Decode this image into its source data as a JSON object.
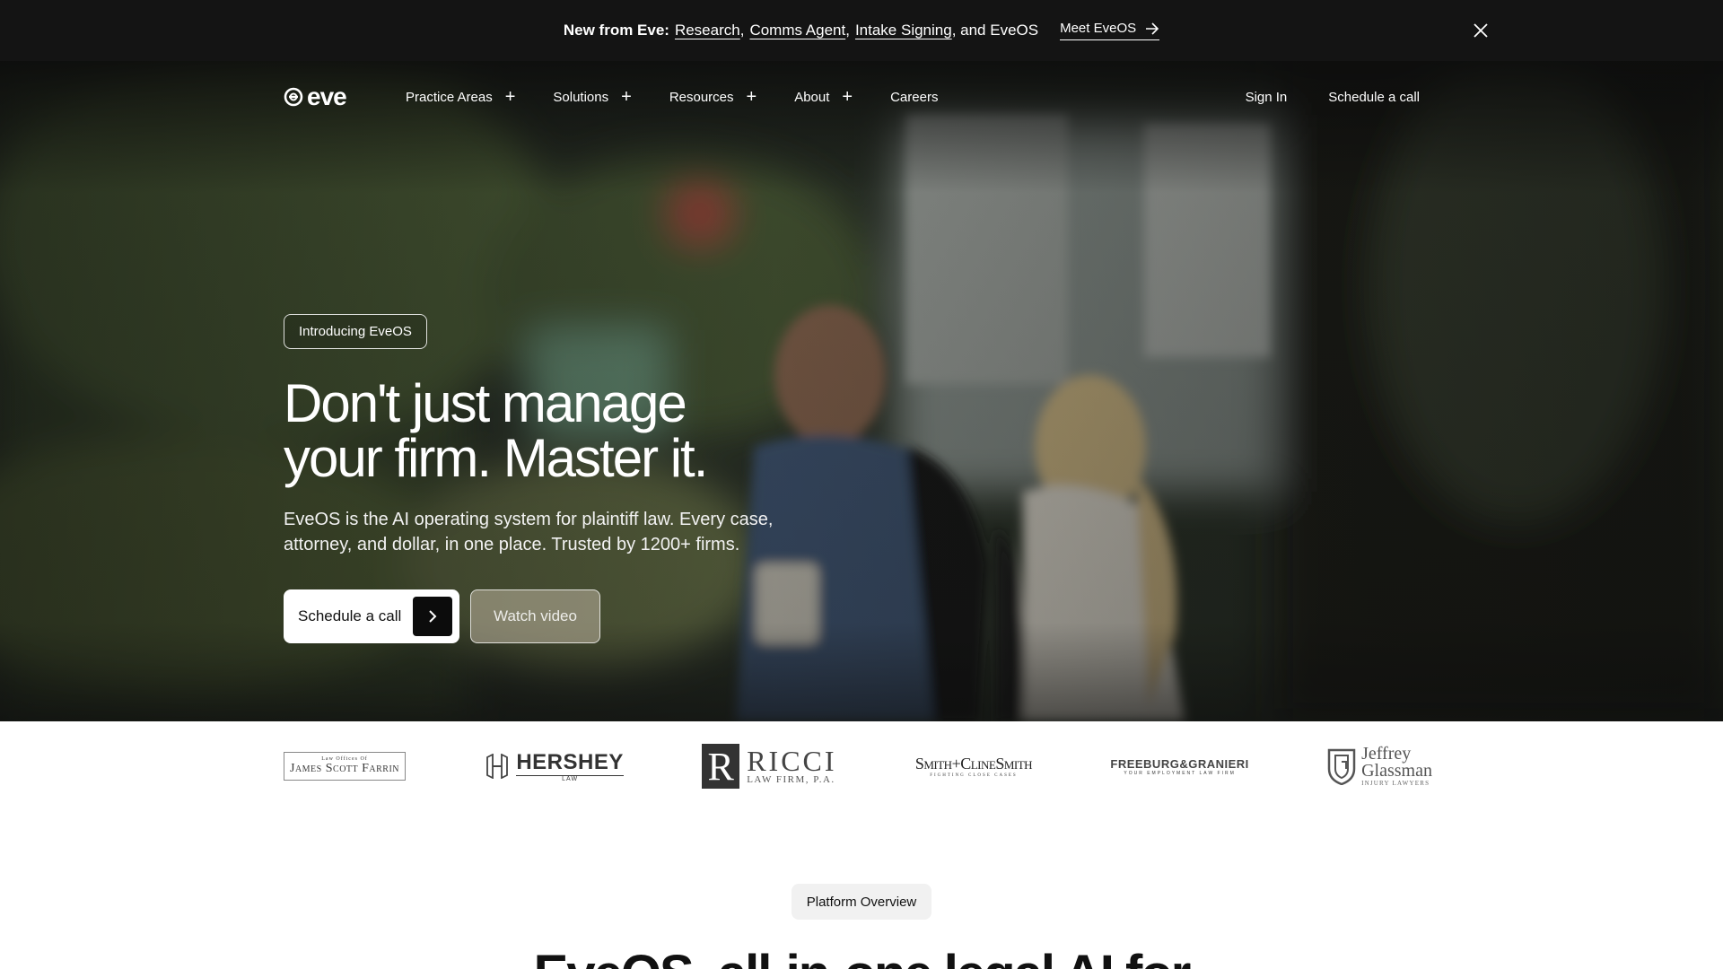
{
  "announcement": {
    "prefix": "New from Eve:",
    "links": [
      "Research",
      "Comms Agent",
      "Intake Signing"
    ],
    "separator": ",",
    "suffix": ", and EveOS",
    "cta_label": "Meet EveOS",
    "close_icon": "close-icon"
  },
  "nav": {
    "brand": "eve",
    "items": [
      {
        "label": "Practice Areas",
        "expandable": true
      },
      {
        "label": "Solutions",
        "expandable": true
      },
      {
        "label": "Resources",
        "expandable": true
      },
      {
        "label": "About",
        "expandable": true
      },
      {
        "label": "Careers",
        "expandable": false
      }
    ],
    "plus_symbol": "+",
    "sign_in": "Sign In",
    "schedule": "Schedule a call"
  },
  "hero": {
    "badge": "Introducing EveOS",
    "headline_line1": "Don't just manage",
    "headline_line2": "your firm. Master it.",
    "subtext": "EveOS is the AI operating system for plaintiff law. Every case, attorney, and dollar, in one place. Trusted by 1200+ firms.",
    "primary_cta": "Schedule a call",
    "secondary_cta": "Watch video"
  },
  "logos": {
    "farrin_small": "Law Offices Of",
    "farrin_name": "James Scott Farrin",
    "hershey_name": "HERSHEY",
    "hershey_sub": "LAW",
    "ricci_letter": "R",
    "ricci_name": "RICCI",
    "ricci_sub": "LAW FIRM, P.A.",
    "smith_name": "Smith+ClineSmith",
    "smith_sub": "FIGHTING CLOSE CASES",
    "freeburg_name": "FREEBURG&GRANIERI",
    "freeburg_sub": "YOUR EMPLOYMENT LAW FIRM",
    "glassman_line1": "Jeffrey",
    "glassman_line2": "Glassman",
    "glassman_sub": "INJURY LAWYERS"
  },
  "overview": {
    "badge": "Platform Overview",
    "heading": "EveOS, all-in-one legal AI for"
  },
  "colors": {
    "announcement_bg": "#141414",
    "hero_overlay": "#1c221d",
    "primary_button_bg": "#ffffff",
    "arrow_box_bg": "#0c0c0c",
    "overview_pill_bg": "#f1f1f1"
  }
}
